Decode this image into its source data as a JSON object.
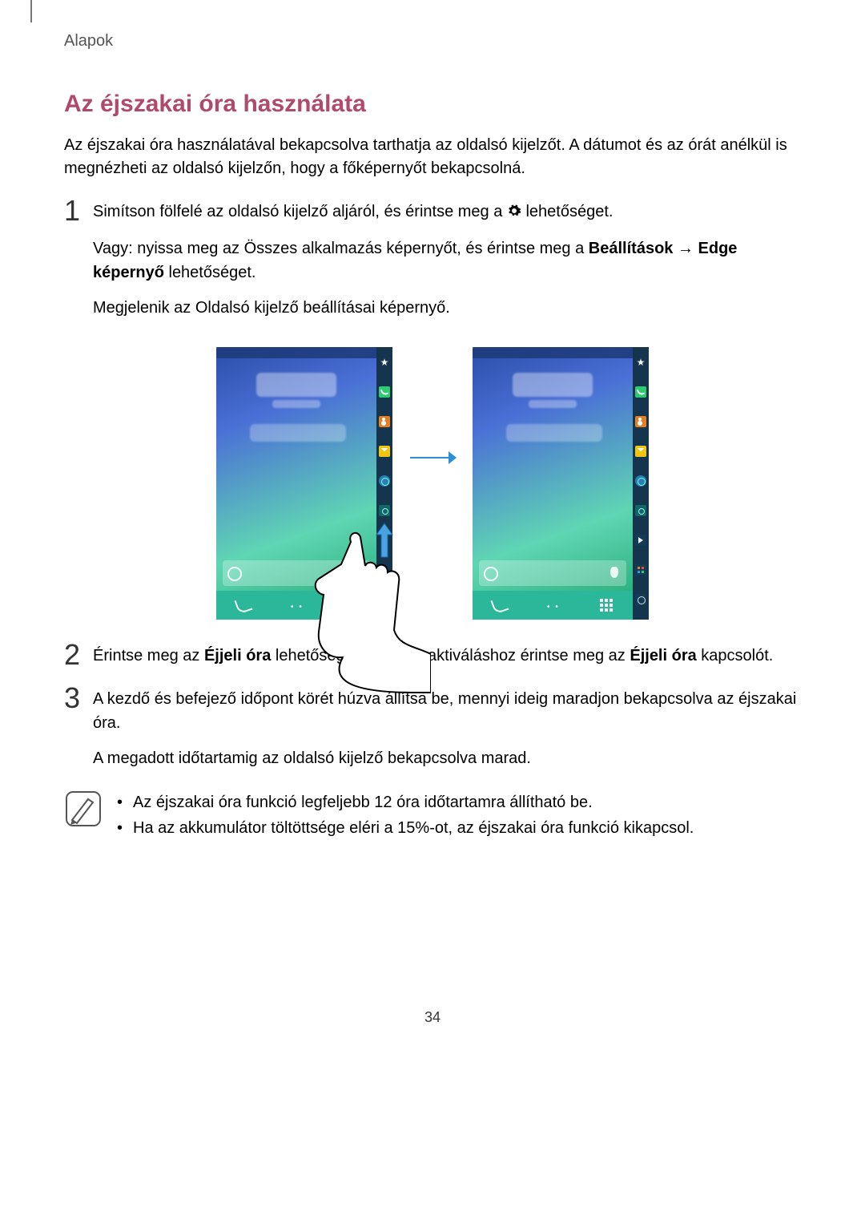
{
  "breadcrumb": "Alapok",
  "section_title": "Az éjszakai óra használata",
  "intro": "Az éjszakai óra használatával bekapcsolva tarthatja az oldalsó kijelzőt. A dátumot és az órát anélkül is megnézheti az oldalsó kijelzőn, hogy a főképernyőt bekapcsolná.",
  "steps": {
    "s1": {
      "num": "1",
      "line1a": "Simítson fölfelé az oldalsó kijelző aljáról, és érintse meg a ",
      "line1b": " lehetőséget.",
      "line2a": "Vagy: nyissa meg az Összes alkalmazás képernyőt, és érintse meg a ",
      "line2b": "Beállítások",
      "line2c": " → ",
      "line2d": "Edge képernyő",
      "line2e": " lehetőséget.",
      "line3": "Megjelenik az Oldalsó kijelző beállításai képernyő."
    },
    "s2": {
      "num": "2",
      "a": "Érintse meg az ",
      "b": "Éjjeli óra",
      "c": " lehetőséget, majd az aktiváláshoz érintse meg az ",
      "d": "Éjjeli óra",
      "e": " kapcsolót."
    },
    "s3": {
      "num": "3",
      "p1": "A kezdő és befejező időpont körét húzva állítsa be, mennyi ideig maradjon bekapcsolva az éjszakai óra.",
      "p2": "A megadott időtartamig az oldalsó kijelző bekapcsolva marad."
    }
  },
  "notes": {
    "n1": "Az éjszakai óra funkció legfeljebb 12 óra időtartamra állítható be.",
    "n2": "Ha az akkumulátor töltöttsége eléri a 15%-ot, az éjszakai óra funkció kikapcsol."
  },
  "page_number": "34",
  "icons": {
    "gear_inline": "gear-icon",
    "edge_left": [
      "star",
      "call",
      "contact",
      "mail",
      "globe",
      "camera",
      "handle-swipe"
    ],
    "edge_right": [
      "star",
      "call",
      "contact",
      "mail",
      "globe",
      "camera",
      "play",
      "squares",
      "gear"
    ]
  }
}
